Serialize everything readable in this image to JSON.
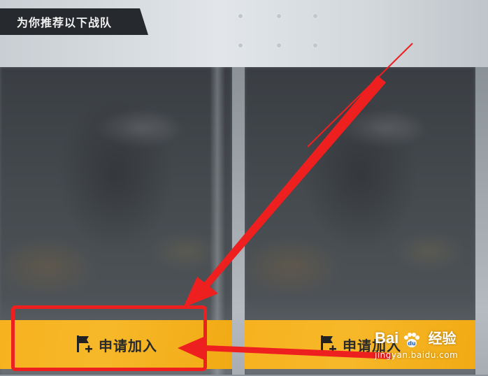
{
  "header": {
    "title": "为你推荐以下战队"
  },
  "cards": [
    {
      "join_label": "申请加入"
    },
    {
      "join_label": "申请加入"
    }
  ],
  "watermark": {
    "brand": "Bai",
    "brand_suffix": "经验",
    "url": "jingyan.baidu.com"
  },
  "annotation_color": "#ee1f1f",
  "button_color": "#f7b21f"
}
